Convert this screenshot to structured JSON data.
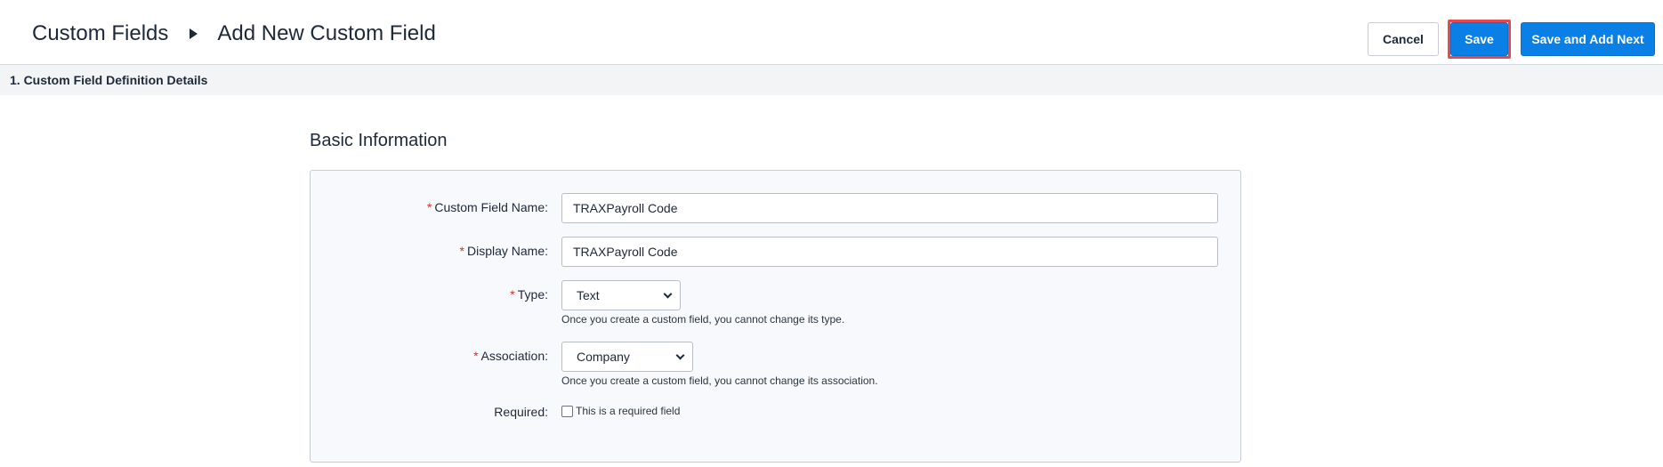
{
  "header": {
    "breadcrumb_parent": "Custom Fields",
    "breadcrumb_current": "Add New Custom Field",
    "cancel_label": "Cancel",
    "save_label": "Save",
    "save_and_add_next_label": "Save and Add Next"
  },
  "section": {
    "step_label": "1. Custom Field Definition Details",
    "title": "Basic Information"
  },
  "form": {
    "custom_field_name": {
      "label": "Custom Field Name:",
      "value": "TRAXPayroll Code"
    },
    "display_name": {
      "label": "Display Name:",
      "value": "TRAXPayroll Code"
    },
    "type": {
      "label": "Type:",
      "selected": "Text",
      "hint": "Once you create a custom field, you cannot change its type."
    },
    "association": {
      "label": "Association:",
      "selected": "Company",
      "hint": "Once you create a custom field, you cannot change its association."
    },
    "required": {
      "label": "Required:",
      "checkbox_label": "This is a required field",
      "checked": false
    }
  },
  "colors": {
    "primary": "#0a7fe6",
    "required_star": "#d92d20",
    "highlight_border": "#e5484d"
  }
}
